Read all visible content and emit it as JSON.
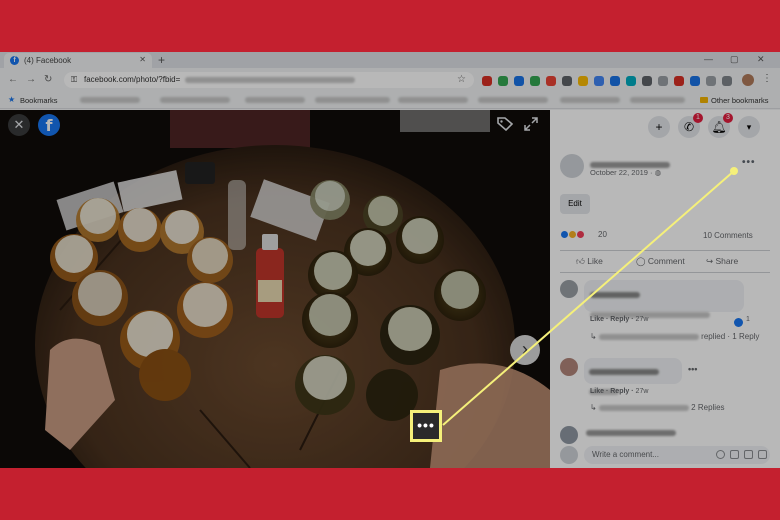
{
  "browser": {
    "tab_title": "(4) Facebook",
    "tab_close": "✕",
    "new_tab": "+",
    "url": "facebook.com/photo/?fbid=",
    "back": "←",
    "forward": "→",
    "reload": "↻",
    "lock": "🔒",
    "star": "☆",
    "menu": "⋮",
    "minimize": "—",
    "restore": "▢",
    "close": "✕",
    "bookmarks_label": "Bookmarks",
    "other_bookmarks": "Other bookmarks"
  },
  "viewer": {
    "close_symbol": "✕",
    "logo": "f",
    "next_symbol": "›",
    "options_symbol": "•••"
  },
  "header_icons": {
    "create": "+",
    "messenger_badge": "1",
    "notifications_badge": "3",
    "account": "▾"
  },
  "post": {
    "date": "October 22, 2019 · ",
    "more": "•••",
    "edit_label": "Edit",
    "reaction_count": "20",
    "comment_count": "10 Comments",
    "like_label": "Like",
    "comment_label": "Comment",
    "share_label": "Share"
  },
  "comments": [
    {
      "like": "Like",
      "reply": "Reply",
      "time": "27w",
      "like_count": "1",
      "replies": "· 1 Reply",
      "reply_prefix": "↳",
      "reply_suffix": "replied"
    },
    {
      "like": "Like",
      "reply": "Reply",
      "time": "27w",
      "replies": "2 Replies",
      "reply_prefix": "↳",
      "more": "•••"
    }
  ],
  "composer": {
    "placeholder": "Write a comment..."
  },
  "colors": {
    "background": "#c4202f",
    "facebook_blue": "#1877f2",
    "highlight": "#f5f07a"
  },
  "icons": {
    "tag": "tag-icon",
    "expand": "expand-icon",
    "messenger": "messenger-icon",
    "notifications": "bell-icon"
  }
}
